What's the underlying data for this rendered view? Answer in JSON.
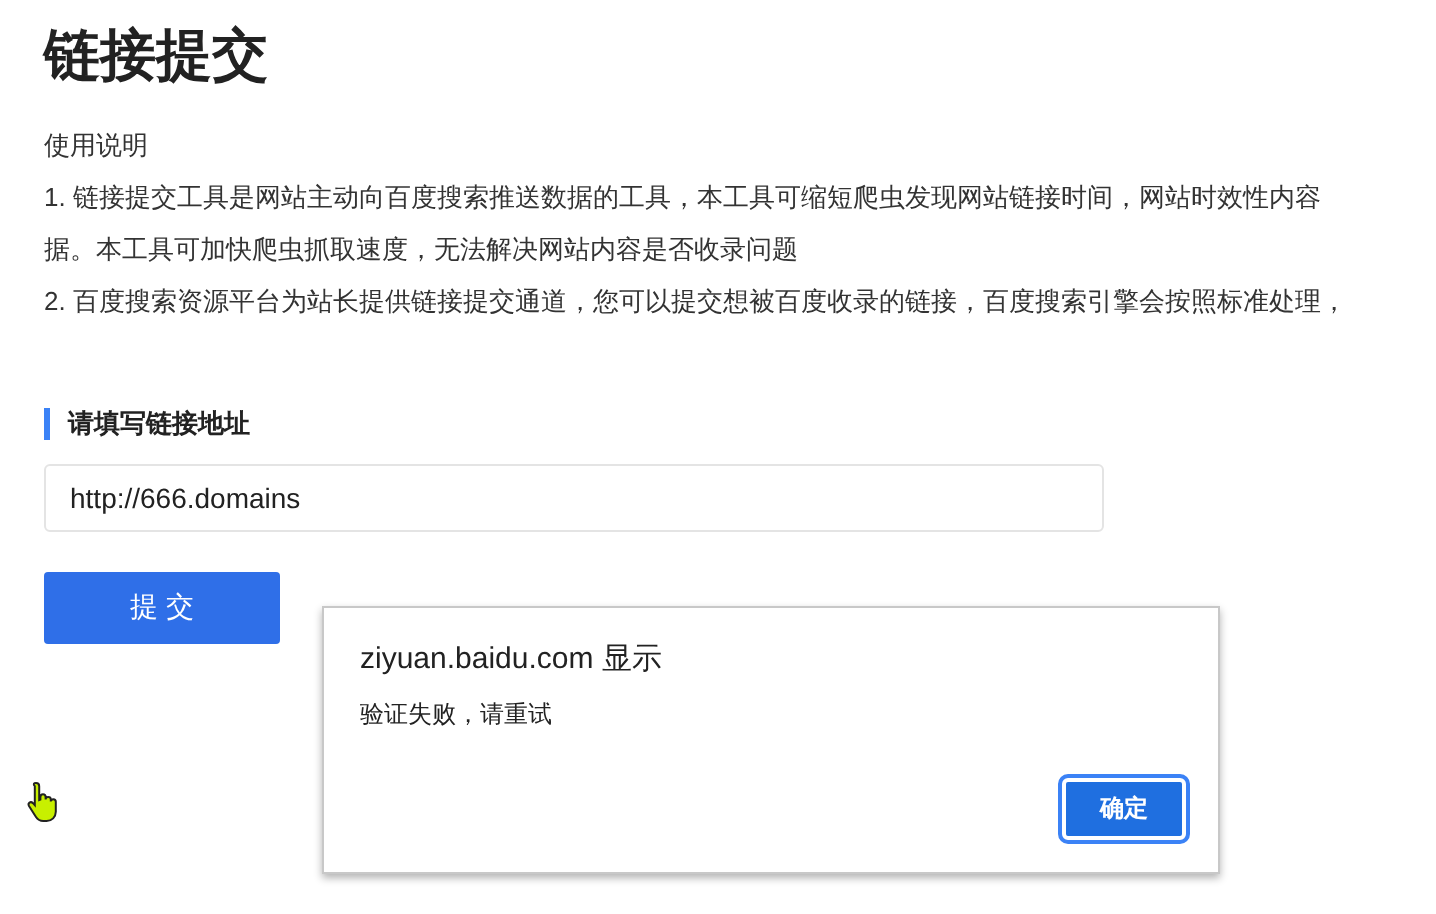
{
  "title": "链接提交",
  "instructions": {
    "heading": "使用说明",
    "lines": [
      "1. 链接提交工具是网站主动向百度搜索推送数据的工具，本工具可缩短爬虫发现网站链接时间，网站时效性内容",
      "据。本工具可加快爬虫抓取速度，无法解决网站内容是否收录问题",
      "2. 百度搜索资源平台为站长提供链接提交通道，您可以提交想被百度收录的链接，百度搜索引擎会按照标准处理，"
    ]
  },
  "form": {
    "label": "请填写链接地址",
    "url_value": "http://666.domains",
    "submit": "提 交"
  },
  "dialog": {
    "title": "ziyuan.baidu.com 显示",
    "message": "验证失败，请重试",
    "ok": "确定"
  }
}
